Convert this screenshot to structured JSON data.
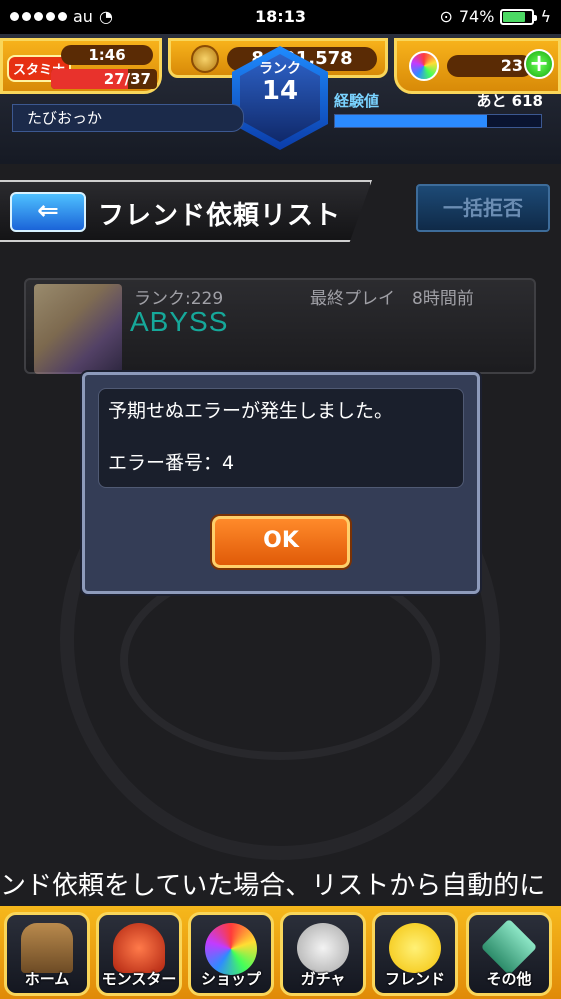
{
  "status_bar": {
    "carrier": "au",
    "time": "18:13",
    "battery": "74%"
  },
  "header": {
    "stamina_label": "スタミナ",
    "stamina_timer": "1:46",
    "stamina_count": "27/37",
    "stamina_fill": 0.73,
    "coins": "8,591,578",
    "orbs": "23",
    "orb_plus": "+",
    "rank_label": "ランク",
    "rank_value": "14",
    "player_name": "たびおっか",
    "exp_label": "経験値",
    "exp_remaining": "あと 618",
    "exp_fill": 0.74
  },
  "title_row": {
    "back_icon": "⇐",
    "title": "フレンド依頼リスト",
    "reject_all": "一括拒否"
  },
  "friend": {
    "rank": "ランク:229",
    "last_play": "最終プレイ　8時間前",
    "name": "ABYSS"
  },
  "dialog": {
    "line1": "予期せぬエラーが発生しました。",
    "line2": "エラー番号：4",
    "ok_label": "OK"
  },
  "ticker": "ンド依頼をしていた場合、リストから自動的に",
  "nav": [
    {
      "label": "ホーム",
      "icon": "home-icon"
    },
    {
      "label": "モンスター",
      "icon": "monster-icon"
    },
    {
      "label": "ショップ",
      "icon": "shop-icon"
    },
    {
      "label": "ガチャ",
      "icon": "gacha-icon"
    },
    {
      "label": "フレンド",
      "icon": "friend-icon"
    },
    {
      "label": "その他",
      "icon": "other-icon"
    }
  ],
  "colors": {
    "accent_gold": "#f7b21b",
    "dialog_bg": "#343d56",
    "ok_orange": "#ff8a2a",
    "exp_blue": "#2b8bff"
  }
}
